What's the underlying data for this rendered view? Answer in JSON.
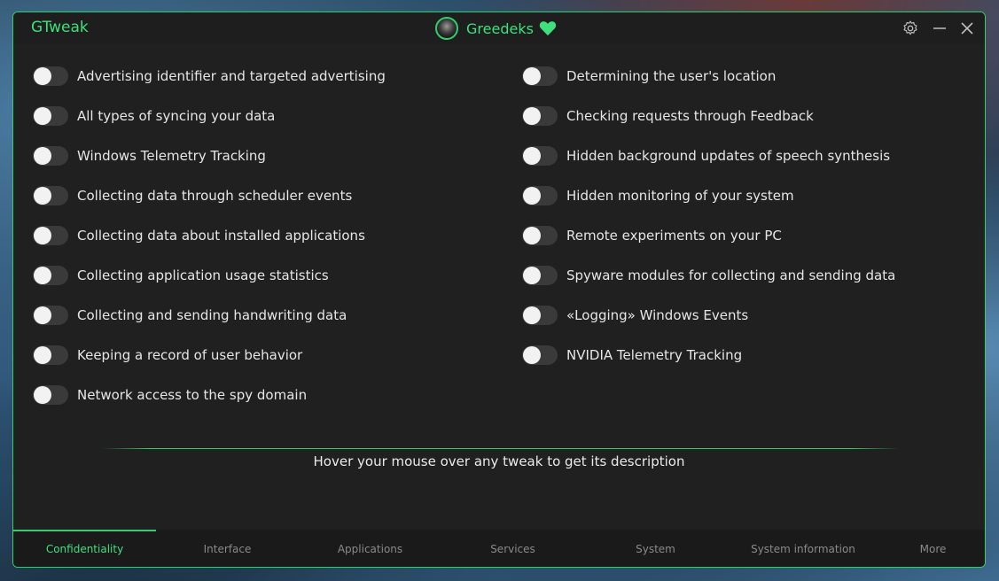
{
  "app": {
    "name": "GTweak"
  },
  "user": {
    "name": "Greedeks"
  },
  "colors": {
    "accent": "#2fcf6a",
    "background": "#202020",
    "text": "#e6e6e6"
  },
  "window_controls": {
    "settings_icon": "gear-icon",
    "minimize_icon": "minimize-icon",
    "close_icon": "close-icon"
  },
  "tweaks_left": [
    {
      "label": "Advertising identifier and targeted advertising",
      "enabled": false
    },
    {
      "label": "All types of syncing your data",
      "enabled": false
    },
    {
      "label": "Windows Telemetry Tracking",
      "enabled": false
    },
    {
      "label": "Collecting data through scheduler events",
      "enabled": false
    },
    {
      "label": "Collecting data about installed applications",
      "enabled": false
    },
    {
      "label": "Collecting application usage statistics",
      "enabled": false
    },
    {
      "label": "Collecting and sending handwriting data",
      "enabled": false
    },
    {
      "label": "Keeping a record of user behavior",
      "enabled": false
    },
    {
      "label": "Network access to the spy domain",
      "enabled": false
    }
  ],
  "tweaks_right": [
    {
      "label": "Determining the user's location",
      "enabled": false
    },
    {
      "label": "Checking requests through Feedback",
      "enabled": false
    },
    {
      "label": "Hidden background updates of speech synthesis",
      "enabled": false
    },
    {
      "label": "Hidden monitoring of your system",
      "enabled": false
    },
    {
      "label": "Remote experiments on your PC",
      "enabled": false
    },
    {
      "label": "Spyware modules for collecting and sending data",
      "enabled": false
    },
    {
      "label": "«Logging» Windows Events",
      "enabled": false
    },
    {
      "label": "NVIDIA Telemetry Tracking",
      "enabled": false
    }
  ],
  "hint": "Hover your mouse over any tweak to get its description",
  "tabs": [
    {
      "label": "Confidentiality",
      "active": true
    },
    {
      "label": "Interface",
      "active": false
    },
    {
      "label": "Applications",
      "active": false
    },
    {
      "label": "Services",
      "active": false
    },
    {
      "label": "System",
      "active": false
    },
    {
      "label": "System information",
      "active": false
    },
    {
      "label": "More",
      "active": false
    }
  ]
}
